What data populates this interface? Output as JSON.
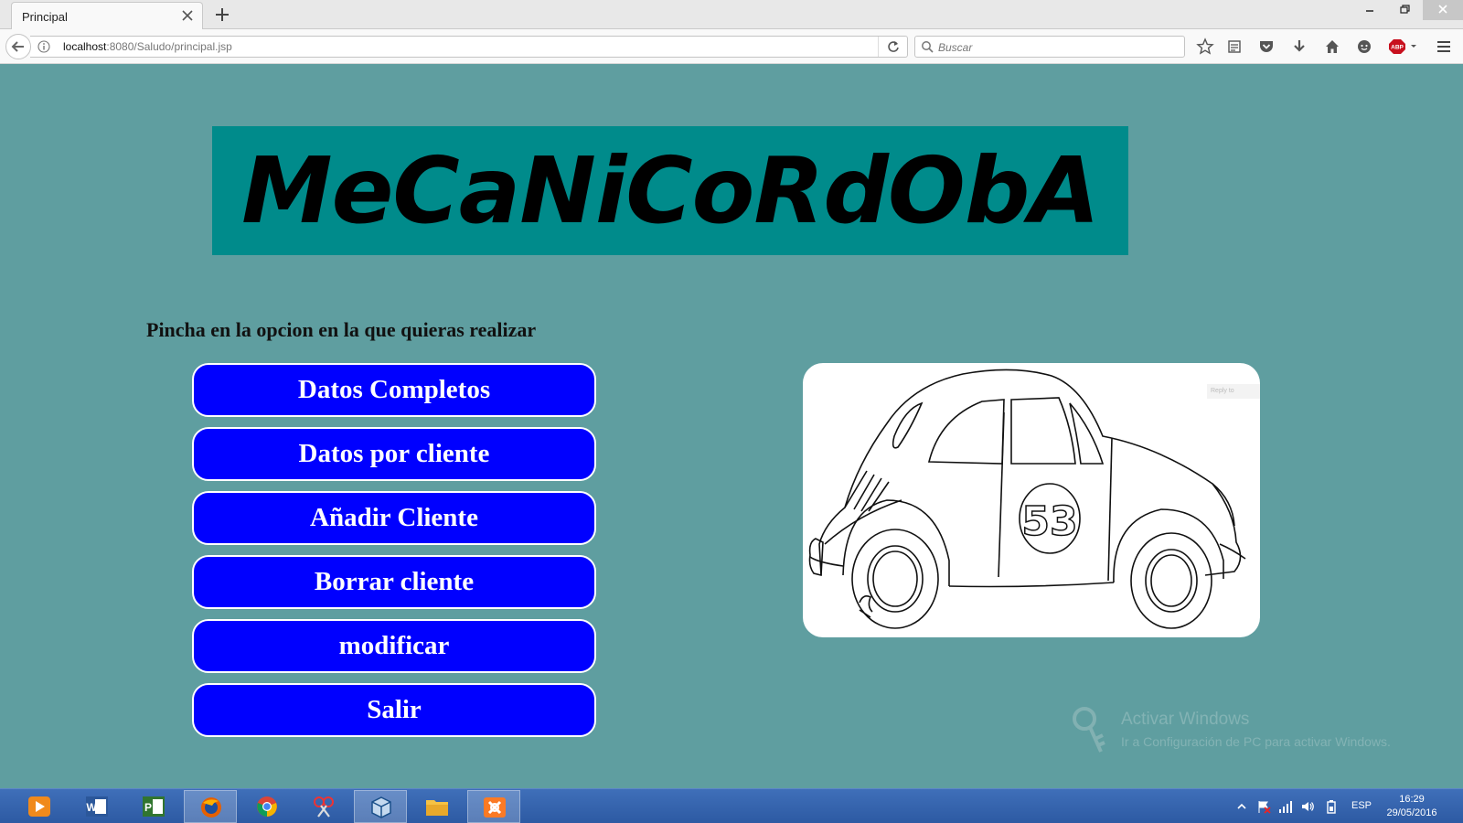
{
  "browser": {
    "tab_title": "Principal",
    "url_host": "localhost",
    "url_path": ":8080/Saludo/principal.jsp",
    "search_placeholder": "Buscar",
    "adblock_label": "ABP"
  },
  "page": {
    "banner_title": "MeCaNiCoRdObA",
    "instruction": "Pincha en la opcion en la que quieras realizar",
    "menu": [
      {
        "label": "Datos Completos"
      },
      {
        "label": "Datos por cliente"
      },
      {
        "label": "Añadir Cliente"
      },
      {
        "label": "Borrar cliente"
      },
      {
        "label": "modificar"
      },
      {
        "label": "Salir"
      }
    ],
    "car_image": {
      "number": "53",
      "chip_text": "Reply to"
    },
    "colors": {
      "background": "#5f9ea0",
      "banner": "#008b8b",
      "button": "#0000ff"
    }
  },
  "watermark": {
    "title": "Activar Windows",
    "subtitle": "Ir a Configuración de PC para activar Windows."
  },
  "taskbar": {
    "apps": [
      "media-player-icon",
      "word-icon",
      "project-icon",
      "firefox-icon",
      "chrome-icon",
      "snipping-tool-icon",
      "virtualbox-icon",
      "file-explorer-icon",
      "xampp-icon"
    ],
    "language": "ESP",
    "time": "16:29",
    "date": "29/05/2016"
  }
}
